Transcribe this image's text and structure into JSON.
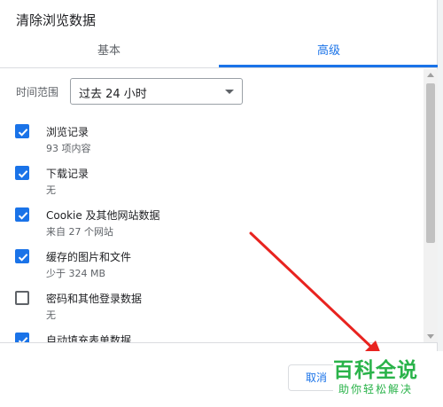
{
  "dialog": {
    "title": "清除浏览数据",
    "tabs": [
      {
        "label": "基本",
        "active": false
      },
      {
        "label": "高级",
        "active": true
      }
    ]
  },
  "time_range": {
    "label": "时间范围",
    "selected": "过去 24 小时"
  },
  "items": [
    {
      "label": "浏览记录",
      "sub": "93 项内容",
      "checked": true
    },
    {
      "label": "下载记录",
      "sub": "无",
      "checked": true
    },
    {
      "label": "Cookie 及其他网站数据",
      "sub": "来自 27 个网站",
      "checked": true
    },
    {
      "label": "缓存的图片和文件",
      "sub": "少于 324 MB",
      "checked": true
    },
    {
      "label": "密码和其他登录数据",
      "sub": "无",
      "checked": false
    },
    {
      "label": "自动填充表单数据",
      "sub": "",
      "checked": true
    }
  ],
  "footer": {
    "cancel_label": "取消"
  },
  "watermark": {
    "main": "百科全说",
    "sub": "助你轻松解决"
  },
  "colors": {
    "accent": "#1a73e8",
    "annotation_arrow": "#e8231f",
    "watermark": "#2ab34a"
  },
  "icons": {
    "checkbox_checked": "check-icon",
    "dropdown": "chevron-down-icon"
  }
}
